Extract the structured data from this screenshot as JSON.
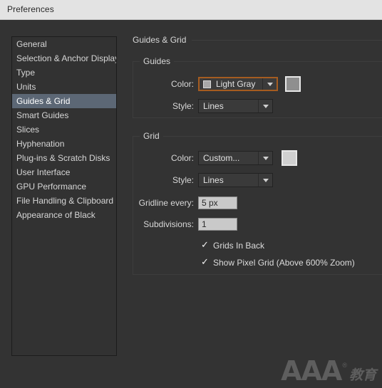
{
  "window": {
    "title": "Preferences"
  },
  "sidebar": {
    "items": [
      {
        "label": "General",
        "selected": false
      },
      {
        "label": "Selection & Anchor Display",
        "selected": false
      },
      {
        "label": "Type",
        "selected": false
      },
      {
        "label": "Units",
        "selected": false
      },
      {
        "label": "Guides & Grid",
        "selected": true
      },
      {
        "label": "Smart Guides",
        "selected": false
      },
      {
        "label": "Slices",
        "selected": false
      },
      {
        "label": "Hyphenation",
        "selected": false
      },
      {
        "label": "Plug-ins & Scratch Disks",
        "selected": false
      },
      {
        "label": "User Interface",
        "selected": false
      },
      {
        "label": "GPU Performance",
        "selected": false
      },
      {
        "label": "File Handling & Clipboard",
        "selected": false
      },
      {
        "label": "Appearance of Black",
        "selected": false
      }
    ]
  },
  "pane": {
    "title": "Guides & Grid",
    "guides": {
      "legend": "Guides",
      "color_label": "Color:",
      "color_value": "Light Gray",
      "color_swatch_hex": "#a8a8a8",
      "color_chip_hex": "#8f8f8f",
      "style_label": "Style:",
      "style_value": "Lines"
    },
    "grid": {
      "legend": "Grid",
      "color_label": "Color:",
      "color_value": "Custom...",
      "color_chip_hex": "#d0d0d0",
      "style_label": "Style:",
      "style_value": "Lines",
      "gridline_label": "Gridline every:",
      "gridline_value": "5 px",
      "subdivisions_label": "Subdivisions:",
      "subdivisions_value": "1",
      "grids_in_back": {
        "label": "Grids In Back",
        "checked": true
      },
      "show_pixel_grid": {
        "label": "Show Pixel Grid (Above 600% Zoom)",
        "checked": true
      }
    }
  },
  "watermark": {
    "mark": "AAA",
    "registered": "®",
    "cn": "教育"
  }
}
